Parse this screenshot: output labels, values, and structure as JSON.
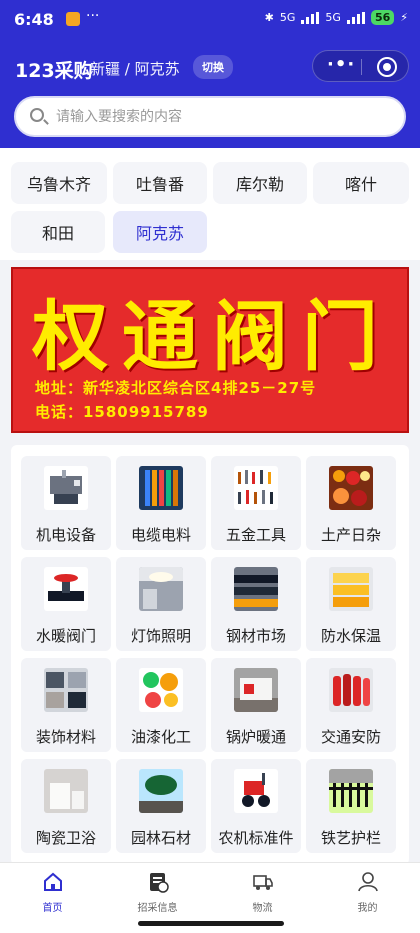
{
  "status_bar": {
    "time": "6:48",
    "battery": "56",
    "network_a": "5G",
    "network_b": "5G",
    "more": "···"
  },
  "header": {
    "brand": "123采购",
    "location": "新疆 / 阿克苏",
    "switch_label": "切换",
    "capsule_more": "·•·"
  },
  "search": {
    "placeholder": "请输入要搜索的内容"
  },
  "cities": [
    {
      "label": "乌鲁木齐",
      "active": false
    },
    {
      "label": "吐鲁番",
      "active": false
    },
    {
      "label": "库尔勒",
      "active": false
    },
    {
      "label": "喀什",
      "active": false
    },
    {
      "label": "和田",
      "active": false
    },
    {
      "label": "阿克苏",
      "active": true
    }
  ],
  "banner": {
    "title": "权通阀门",
    "address": "地址：新华凌北区综合区4排25－27号",
    "phone": "电话：15809915789"
  },
  "categories": [
    {
      "label": "机电设备",
      "icon": "machine-icon"
    },
    {
      "label": "电缆电料",
      "icon": "cable-icon"
    },
    {
      "label": "五金工具",
      "icon": "tools-icon"
    },
    {
      "label": "土产日杂",
      "icon": "sundries-icon"
    },
    {
      "label": "水暖阀门",
      "icon": "valve-icon"
    },
    {
      "label": "灯饰照明",
      "icon": "lamp-icon"
    },
    {
      "label": "钢材市场",
      "icon": "steel-icon"
    },
    {
      "label": "防水保温",
      "icon": "insulation-icon"
    },
    {
      "label": "装饰材料",
      "icon": "decoration-icon"
    },
    {
      "label": "油漆化工",
      "icon": "paint-icon"
    },
    {
      "label": "锅炉暖通",
      "icon": "boiler-icon"
    },
    {
      "label": "交通安防",
      "icon": "safety-icon"
    },
    {
      "label": "陶瓷卫浴",
      "icon": "bathroom-icon"
    },
    {
      "label": "园林石材",
      "icon": "garden-icon"
    },
    {
      "label": "农机标准件",
      "icon": "farm-machine-icon"
    },
    {
      "label": "铁艺护栏",
      "icon": "fence-icon"
    }
  ],
  "tabs": [
    {
      "label": "首页",
      "icon": "home-icon",
      "active": true
    },
    {
      "label": "招采信息",
      "icon": "document-icon",
      "active": false
    },
    {
      "label": "物流",
      "icon": "truck-icon",
      "active": false
    },
    {
      "label": "我的",
      "icon": "user-icon",
      "active": false
    }
  ],
  "colors": {
    "primary": "#2f2fd0",
    "banner_red": "#e52b2b",
    "banner_yellow": "#ffec00"
  }
}
